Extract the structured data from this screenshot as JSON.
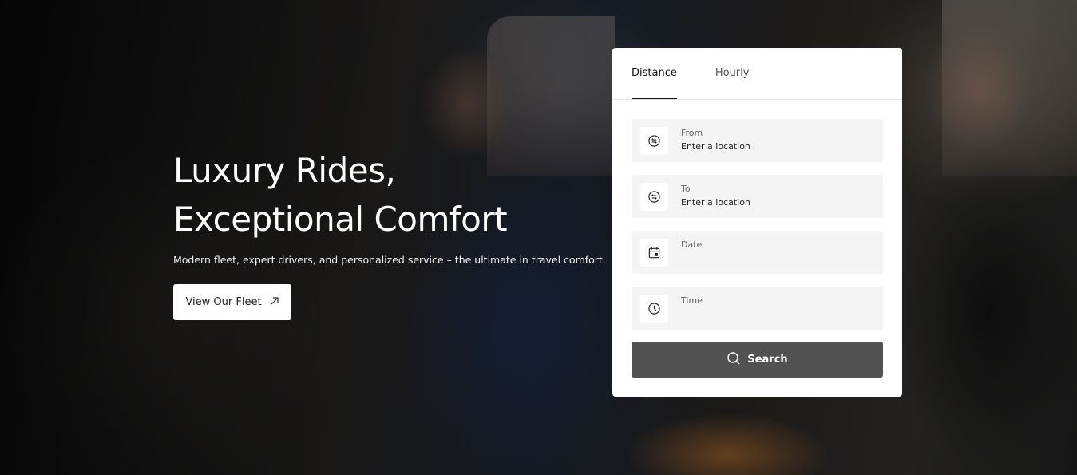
{
  "hero": {
    "title_line1": "Luxury Rides,",
    "title_line2": "Exceptional Comfort",
    "subtitle": "Modern fleet, expert drivers, and personalized service – the ultimate in travel comfort.",
    "cta_label": "View Our Fleet",
    "cta_icon": "arrow-up-right-icon"
  },
  "booking": {
    "tabs": [
      {
        "label": "Distance",
        "active": true
      },
      {
        "label": "Hourly",
        "active": false
      }
    ],
    "fields": {
      "from": {
        "label": "From",
        "placeholder": "Enter a location",
        "icon": "location-swap-icon"
      },
      "to": {
        "label": "To",
        "placeholder": "Enter a location",
        "icon": "location-swap-icon"
      },
      "date": {
        "label": "Date",
        "value": "",
        "icon": "calendar-icon"
      },
      "time": {
        "label": "Time",
        "value": "",
        "icon": "clock-icon"
      }
    },
    "search_label": "Search",
    "search_icon": "search-icon"
  },
  "colors": {
    "search_button": "#525252",
    "card_background": "#ffffff",
    "field_background": "#f4f4f4"
  }
}
